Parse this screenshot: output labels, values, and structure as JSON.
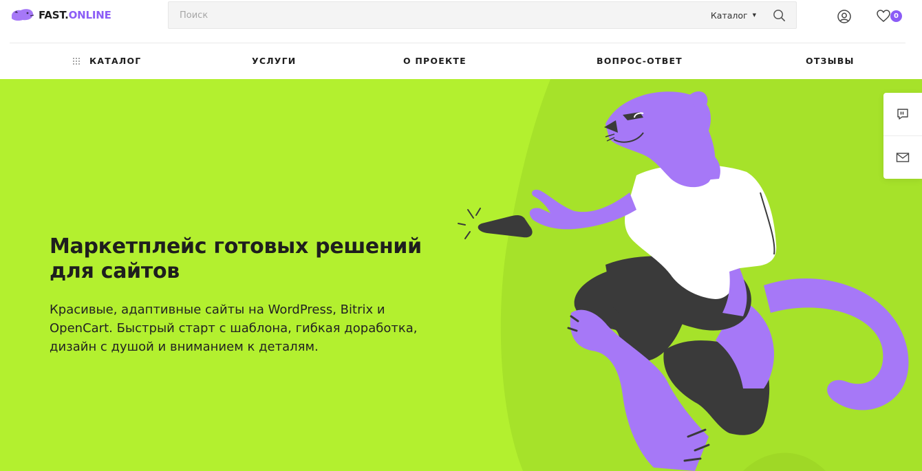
{
  "brand": {
    "name_main": "FAST.",
    "name_accent": "ONLINE",
    "accent_color": "#8b5cf6"
  },
  "search": {
    "placeholder": "Поиск",
    "category_label": "Каталог"
  },
  "header": {
    "favorites_count": "0"
  },
  "nav": {
    "items": [
      {
        "label": "Каталог"
      },
      {
        "label": "Услуги"
      },
      {
        "label": "О проекте"
      },
      {
        "label": "Вопрос-ответ"
      },
      {
        "label": "Отзывы"
      }
    ]
  },
  "hero": {
    "title": "Маркетплейс готовых решений для сайтов",
    "text": "Красивые, адаптивные сайты на WordPress, Bitrix и OpenCart. Быстрый старт с шаблона, гибкая доработка, дизайн с душой и вниманием к деталям.",
    "background_color": "#b3f02f",
    "illustration": "purple-panther-with-phone"
  },
  "side_widget": {
    "icons": [
      "chat-quote-icon",
      "mail-icon"
    ]
  }
}
